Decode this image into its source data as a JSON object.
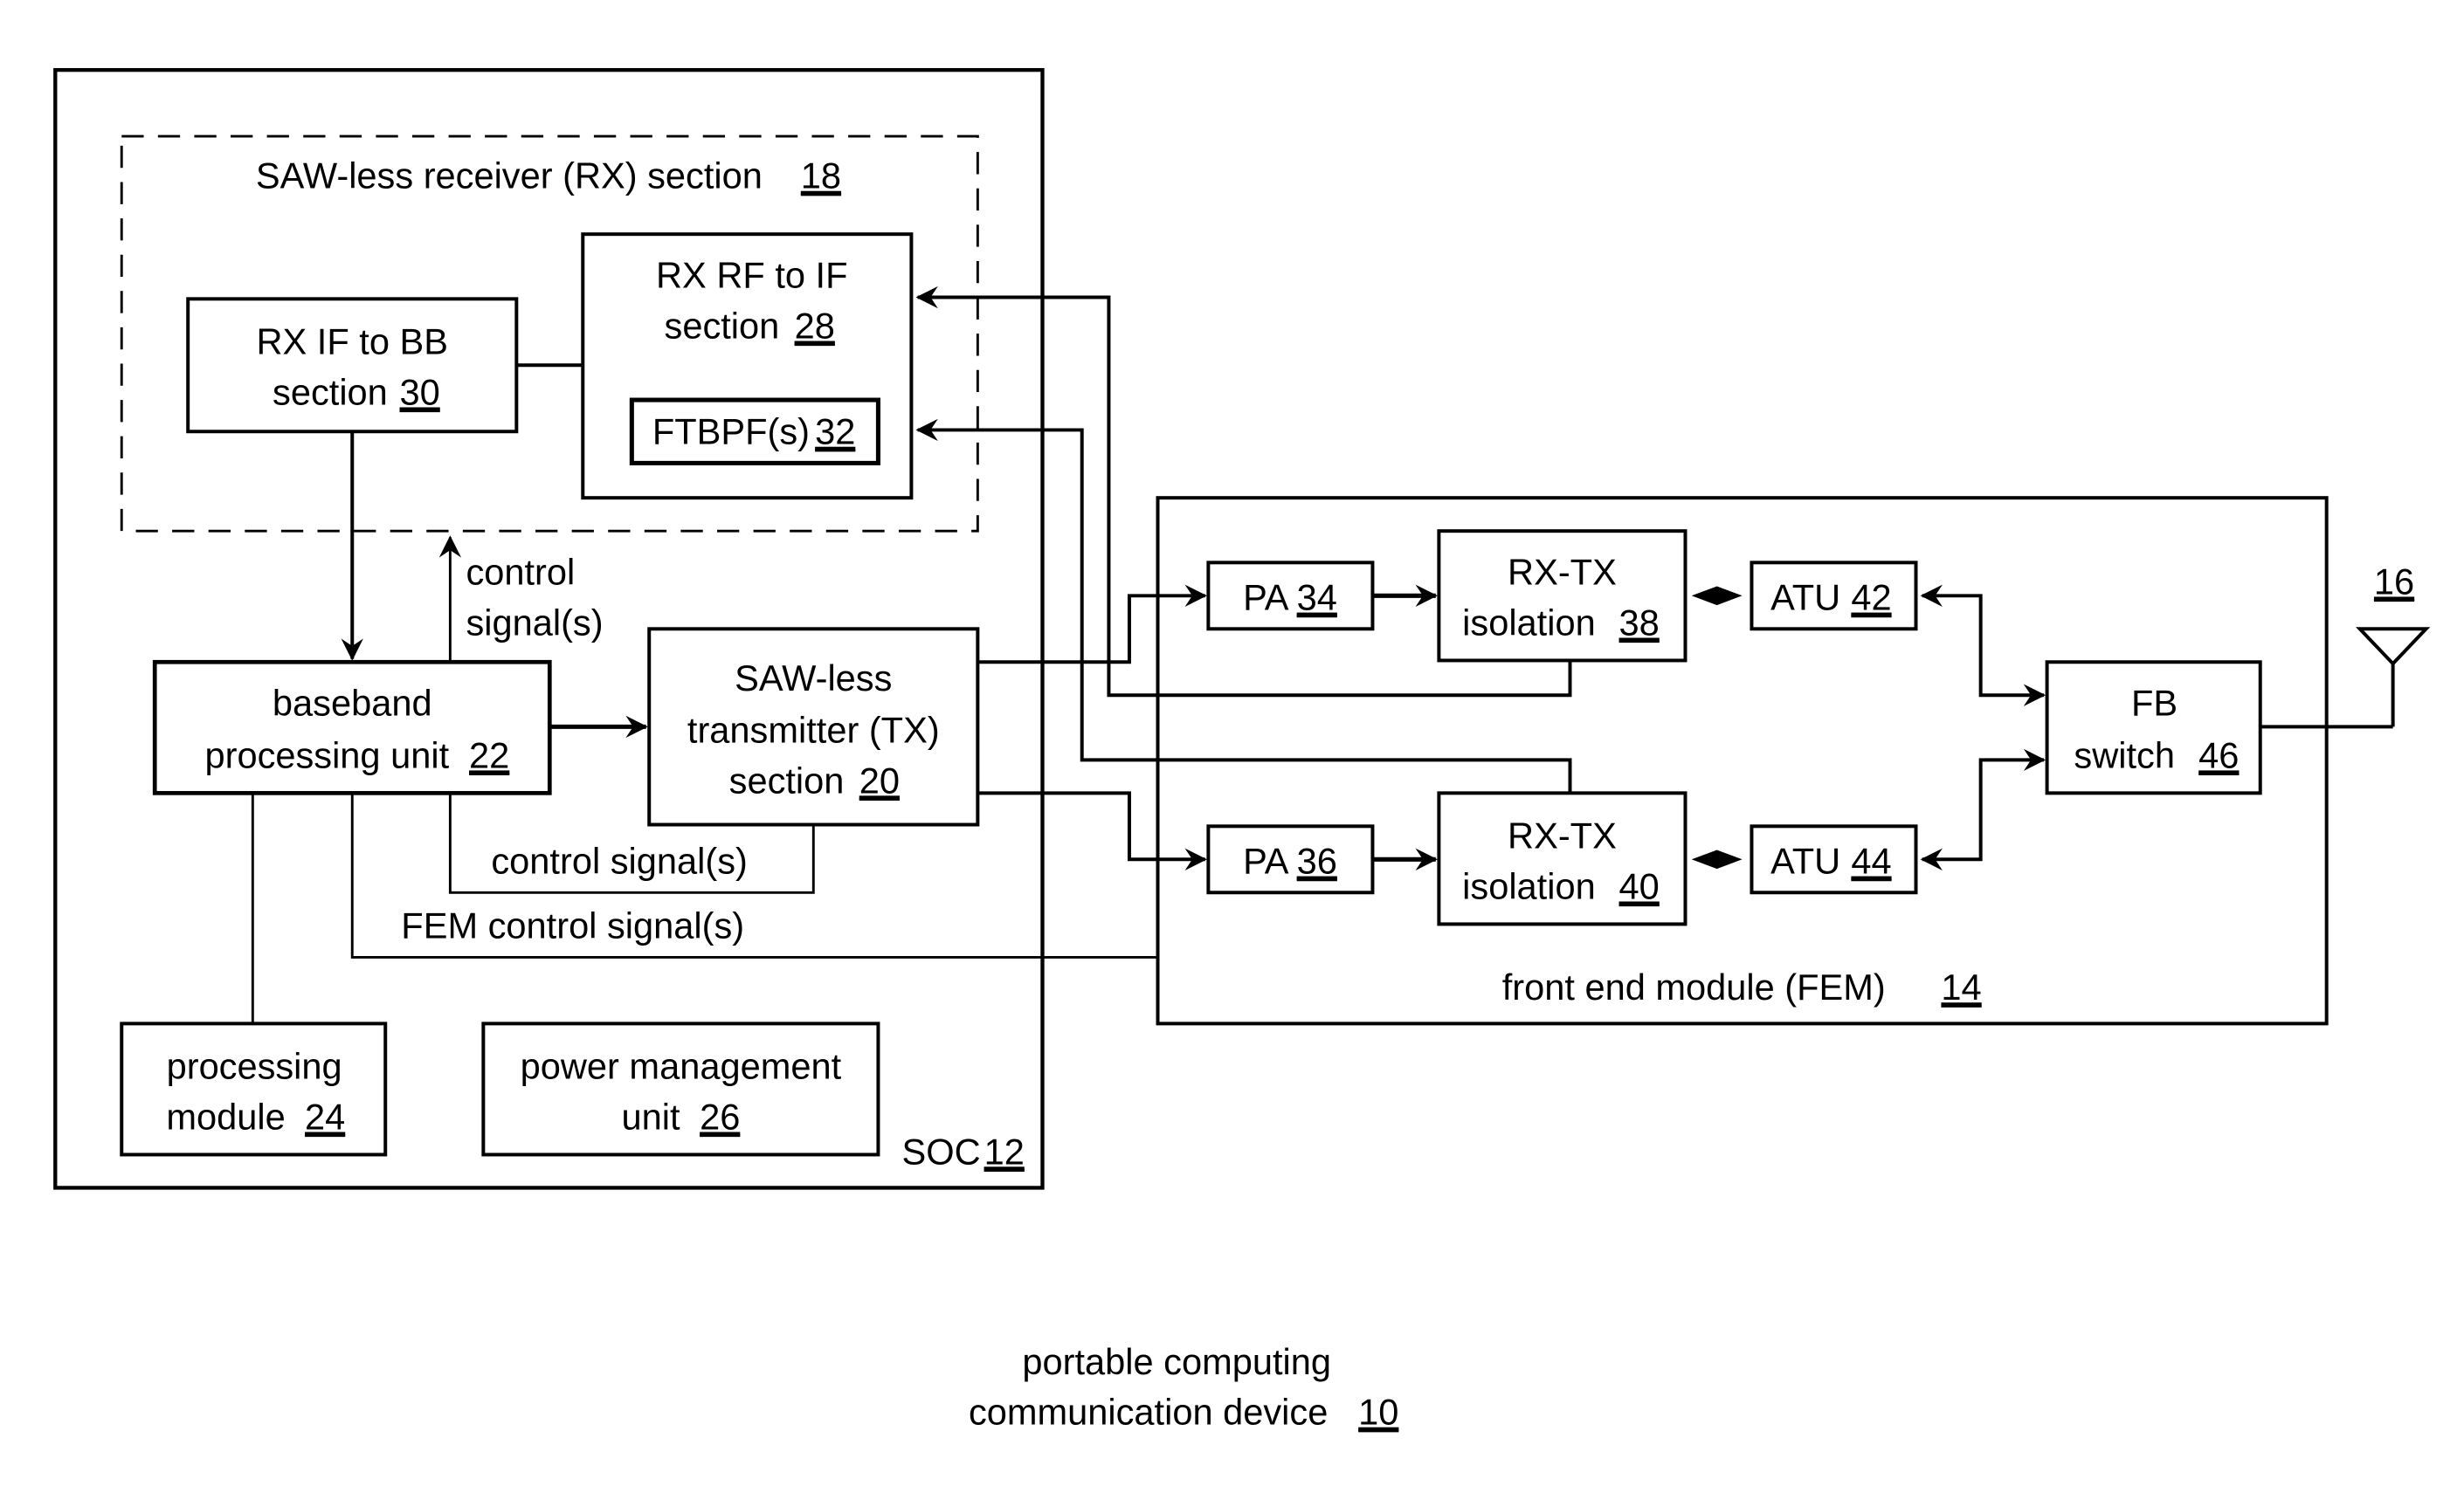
{
  "figure": {
    "type": "block-diagram",
    "caption": {
      "line1": "portable computing",
      "line2": "communication device",
      "ref": "10"
    }
  },
  "blocks": {
    "soc": {
      "label": "SOC",
      "ref": "12"
    },
    "rx_section": {
      "label": "SAW-less receiver (RX) section",
      "ref": "18"
    },
    "rx_if_bb": {
      "line1": "RX IF to BB",
      "line2": "section",
      "ref": "30"
    },
    "rx_rf_if": {
      "line1": "RX RF to IF",
      "line2": "section",
      "ref": "28"
    },
    "ftbpf": {
      "label": "FTBPF(s)",
      "ref": "32"
    },
    "baseband": {
      "line1": "baseband",
      "line2": "processing unit",
      "ref": "22"
    },
    "tx_section": {
      "line1": "SAW-less",
      "line2": "transmitter (TX)",
      "line3": "section",
      "ref": "20"
    },
    "processing_module": {
      "line1": "processing",
      "line2": "module",
      "ref": "24"
    },
    "power_mgmt": {
      "line1": "power management",
      "line2": "unit",
      "ref": "26"
    },
    "fem": {
      "label": "front end module (FEM)",
      "ref": "14"
    },
    "pa34": {
      "label": "PA",
      "ref": "34"
    },
    "pa36": {
      "label": "PA",
      "ref": "36"
    },
    "iso38": {
      "line1": "RX-TX",
      "line2": "isolation",
      "ref": "38"
    },
    "iso40": {
      "line1": "RX-TX",
      "line2": "isolation",
      "ref": "40"
    },
    "atu42": {
      "label": "ATU",
      "ref": "42"
    },
    "atu44": {
      "label": "ATU",
      "ref": "44"
    },
    "fb_switch": {
      "line1": "FB",
      "line2": "switch",
      "ref": "46"
    },
    "antenna": {
      "ref": "16"
    }
  },
  "signals": {
    "rx_control": {
      "line1": "control",
      "line2": "signal(s)"
    },
    "tx_control": {
      "label": "control signal(s)"
    },
    "fem_control": {
      "label": "FEM control signal(s)"
    }
  }
}
